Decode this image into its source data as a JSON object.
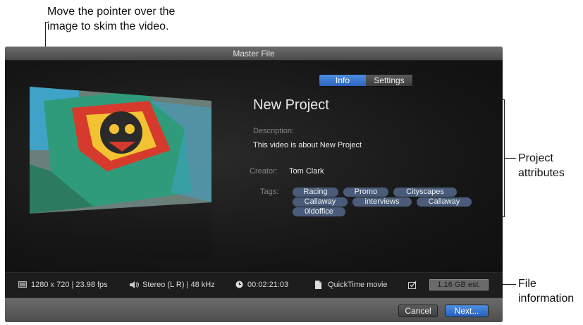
{
  "callouts": {
    "skim_line1": "Move the pointer over the",
    "skim_line2": "image to skim the video.",
    "attributes_line1": "Project",
    "attributes_line2": "attributes",
    "fileinfo_line1": "File",
    "fileinfo_line2": "information"
  },
  "window": {
    "title": "Master File"
  },
  "tabs": [
    {
      "label": "Info",
      "selected": true
    },
    {
      "label": "Settings",
      "selected": false
    }
  ],
  "project": {
    "name": "New Project",
    "description_label": "Description:",
    "description": "This video is about New Project",
    "creator_label": "Creator:",
    "creator": "Tom Clark",
    "tags_label": "Tags:",
    "tags": [
      "Racing",
      "Promo",
      "Cityscapes",
      "Callaway",
      "interviews",
      "Callaway",
      "0ldoffice"
    ]
  },
  "file_info": {
    "resolution": "1280 x 720 | 23.98 fps",
    "audio": "Stereo (L R) | 48 kHz",
    "duration": "00:02:21:03",
    "format": "QuickTime movie",
    "size": "1.16 GB est."
  },
  "buttons": {
    "cancel": "Cancel",
    "next": "Next..."
  },
  "colors": {
    "accent": "#3a78d6",
    "tag": "#4a5c79"
  },
  "icons": [
    "film-icon",
    "speaker-icon",
    "clock-icon",
    "document-icon",
    "checkbox-icon"
  ]
}
